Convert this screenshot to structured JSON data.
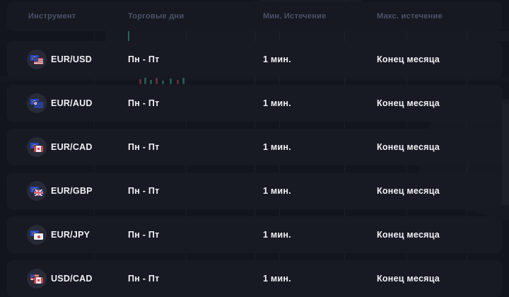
{
  "colors": {
    "page_background": "#12151d",
    "card_background": "#171a23",
    "header_text": "#4c5365",
    "row_text": "#f1f2f6",
    "chart_accent_teal": "#40aa96"
  },
  "table": {
    "columns": [
      {
        "label": "Инструмент"
      },
      {
        "label": "Торговые дни"
      },
      {
        "label": "Мин. Истечение"
      },
      {
        "label": "Макс. истечение"
      }
    ],
    "rows": [
      {
        "instrument": "EUR/USD",
        "base_flag": "eu",
        "quote_flag": "us",
        "trading_days": "Пн - Пт",
        "min_expiration": "1 мин.",
        "max_expiration": "Конец месяца"
      },
      {
        "instrument": "EUR/AUD",
        "base_flag": "eu",
        "quote_flag": "au",
        "trading_days": "Пн - Пт",
        "min_expiration": "1 мин.",
        "max_expiration": "Конец месяца"
      },
      {
        "instrument": "EUR/CAD",
        "base_flag": "eu",
        "quote_flag": "ca",
        "trading_days": "Пн - Пт",
        "min_expiration": "1 мин.",
        "max_expiration": "Конец месяца"
      },
      {
        "instrument": "EUR/GBP",
        "base_flag": "eu",
        "quote_flag": "gb",
        "trading_days": "Пн - Пт",
        "min_expiration": "1 мин.",
        "max_expiration": "Конец месяца"
      },
      {
        "instrument": "EUR/JPY",
        "base_flag": "eu",
        "quote_flag": "jp",
        "trading_days": "Пн - Пт",
        "min_expiration": "1 мин.",
        "max_expiration": "Конец месяца"
      },
      {
        "instrument": "USD/CAD",
        "base_flag": "us",
        "quote_flag": "ca",
        "trading_days": "Пн - Пт",
        "min_expiration": "1 мин.",
        "max_expiration": "Конец месяца"
      }
    ]
  }
}
